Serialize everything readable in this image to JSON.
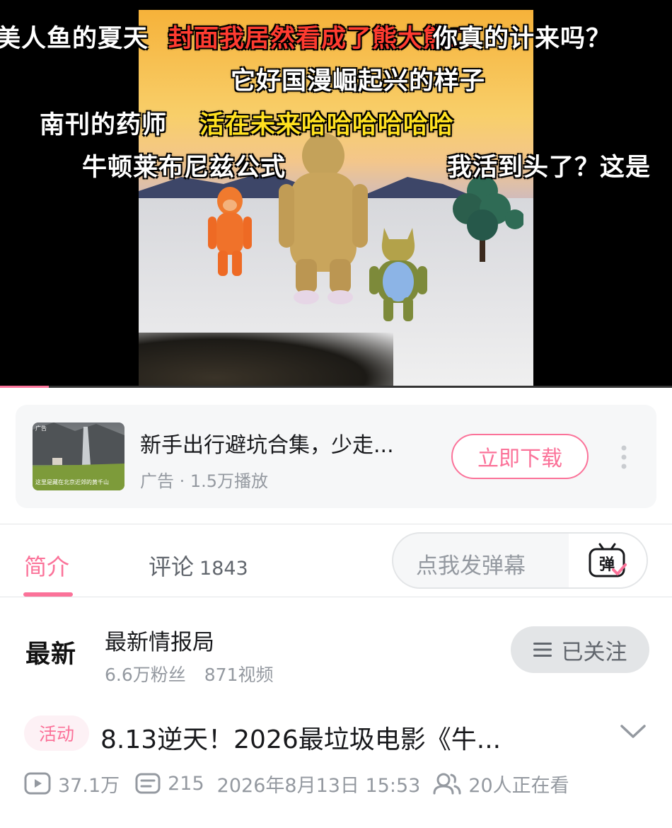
{
  "player": {
    "danmaku": [
      {
        "text": "美人鱼的夏天",
        "color": "white"
      },
      {
        "text": "封面我居然看成了熊大熊二",
        "color": "red"
      },
      {
        "text": "你真的计来吗？",
        "color": "white"
      },
      {
        "text": "它好国漫崛起兴的样子",
        "color": "white"
      },
      {
        "text": "南刊的药师",
        "color": "white"
      },
      {
        "text": "活在未来哈哈哈哈哈哈",
        "color": "yellow"
      },
      {
        "text": "牛顿莱布尼兹公式",
        "color": "white"
      },
      {
        "text": "我活到头了？这是",
        "color": "white"
      }
    ],
    "progress_fraction": 0.073
  },
  "ad": {
    "title": "新手出行避坑合集，少走...",
    "meta": "广告 · 1.5万播放",
    "button_label": "立即下载",
    "thumb_tag": "广告",
    "thumb_caption": "这里是藏在北京近郊的黄千山"
  },
  "tabs": {
    "intro_label": "简介",
    "comments_label": "评论",
    "comments_count": "1843",
    "danmaku_placeholder": "点我发弹幕",
    "danmaku_icon_label": "弹"
  },
  "uploader": {
    "logo_text": "最新",
    "name": "最新情报局",
    "followers": "6.6万粉丝",
    "videos": "871视频",
    "follow_label": "已关注"
  },
  "video": {
    "tag": "活动",
    "title": "8.13逆天！2026最垃圾电影《牛...",
    "views": "37.1万",
    "danmaku_count": "215",
    "date": "2026年8月13日 15:53",
    "watching": "20人正在看"
  },
  "colors": {
    "accent": "#fb7299",
    "text_secondary": "#9499a0",
    "follow_bg": "#e3e5e7"
  }
}
